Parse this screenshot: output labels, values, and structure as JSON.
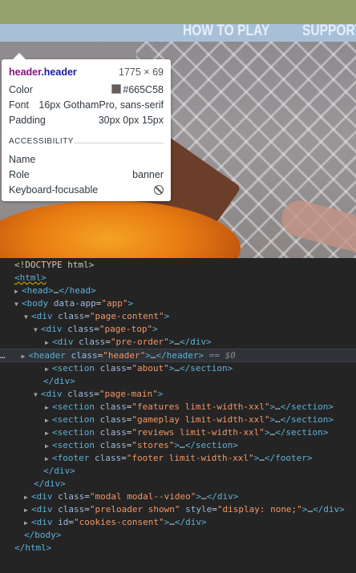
{
  "nav": {
    "items": [
      "HOW TO PLAY",
      "SUPPORT"
    ]
  },
  "tooltip": {
    "tag": "header",
    "class": ".header",
    "size": "1775 × 69",
    "rows": [
      {
        "label": "Color",
        "value": "#665C58"
      },
      {
        "label": "Font",
        "value": "16px GothamPro, sans-serif"
      },
      {
        "label": "Padding",
        "value": "30px 0px 15px"
      }
    ],
    "accessibility_title": "ACCESSIBILITY",
    "a11y": [
      {
        "label": "Name",
        "value": ""
      },
      {
        "label": "Role",
        "value": "banner"
      },
      {
        "label": "Keyboard-focusable",
        "value": ""
      }
    ],
    "swatch_color": "#665C58"
  },
  "dom": {
    "doctype": "<!DOCTYPE html>",
    "selected_marker": "== $0",
    "ellipsis": "…",
    "lines": [
      {
        "t": "html-open"
      },
      {
        "t": "head"
      },
      {
        "t": "body"
      },
      {
        "t": "page-content"
      },
      {
        "t": "page-top"
      },
      {
        "t": "pre-order"
      },
      {
        "t": "header"
      },
      {
        "t": "about"
      },
      {
        "t": "div-close"
      },
      {
        "t": "page-main"
      },
      {
        "t": "features"
      },
      {
        "t": "gameplay"
      },
      {
        "t": "reviews"
      },
      {
        "t": "stores"
      },
      {
        "t": "footer"
      }
    ]
  }
}
